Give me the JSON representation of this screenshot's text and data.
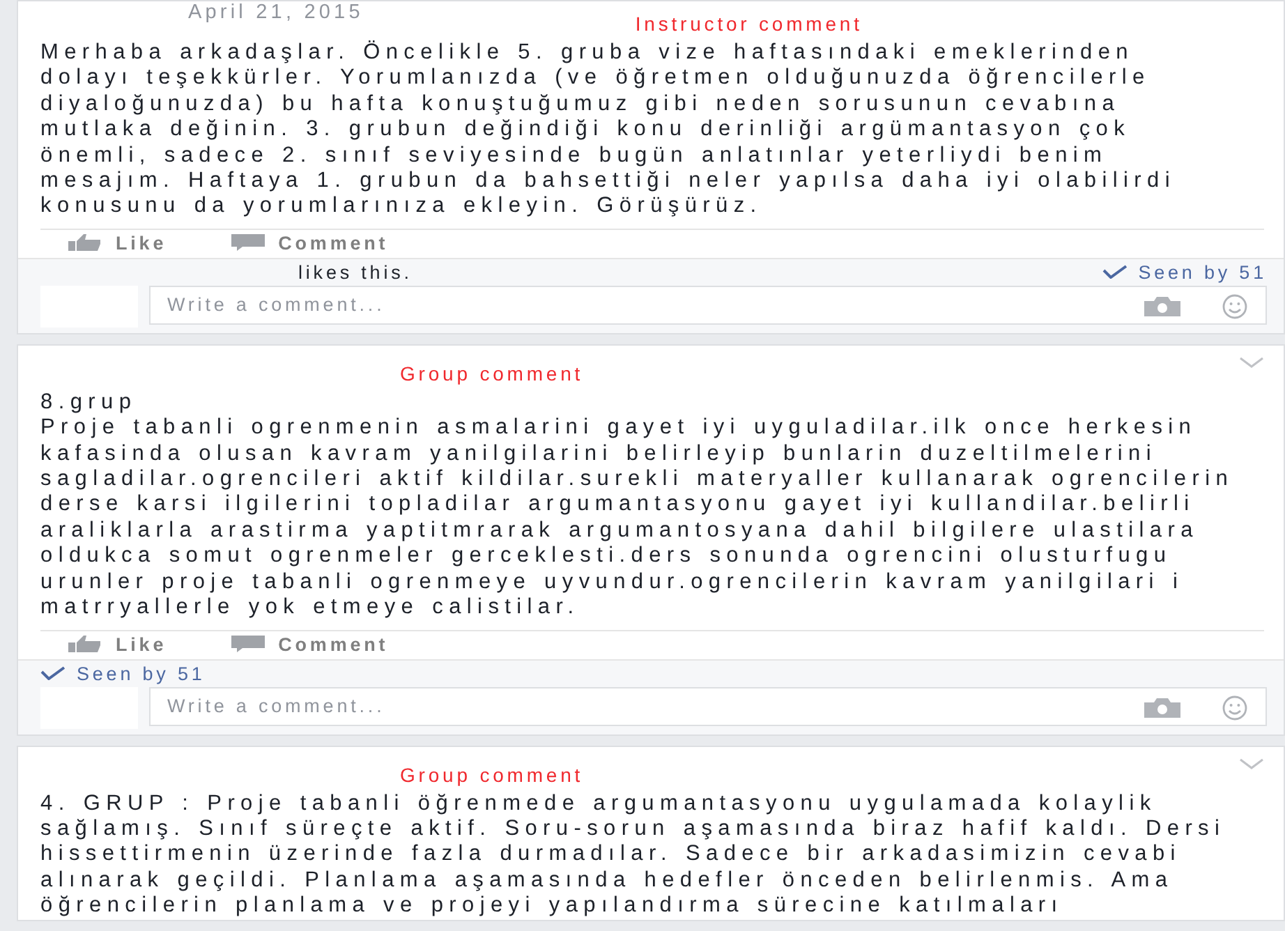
{
  "posts": [
    {
      "date": "April 21, 2015",
      "heading": "Instructor comment",
      "body": "Merhaba arkadaşlar. Öncelikle 5. gruba vize haftasındaki emeklerinden\ndolayı teşekkürler. Yorumlanızda (ve öğretmen olduğunuzda öğrencilerle\ndiyaloğunuzda) bu hafta konuştuğumuz gibi neden sorusunun cevabına\nmutlaka değinin. 3. grubun değindiği konu derinliği argümantasyon çok\nönemli, sadece 2. sınıf seviyesinde bugün anlatınlar yeterliydi benim\nmesajım. Haftaya 1. grubun da bahsettiği neler yapılsa daha iyi olabilirdi\nkonusunu da yorumlarınıza ekleyin. Görüşürüz.",
      "actions": [
        "Like",
        "Comment"
      ],
      "likes": "likes this.",
      "seen": "Seen by 51",
      "comment_placeholder": "Write a comment...",
      "menu": false
    },
    {
      "heading": "Group comment",
      "body": "8.grup\nProje tabanli ogrenmenin asmalarini gayet iyi uyguladilar.ilk once herkesin\nkafasinda olusan kavram yanilgilarini belirleyip bunlarin duzeltilmelerini\nsagladilar.ogrencileri aktif kildilar.surekli materyaller kullanarak ogrencilerin\nderse karsi ilgilerini topladilar argumantasyonu gayet iyi kullandilar.belirli\naraliklarla arastirma yaptitmrarak argumantosyana dahil bilgilere ulastilara\noldukca somut ogrenmeler gerceklesti.ders sonunda ogrencini olusturfugu\nurunler proje tabanli ogrenmeye uyvundur.ogrencilerin kavram yanilgilari i\nmatrryallerle yok etmeye calistilar.",
      "actions": [
        "Like",
        "Comment"
      ],
      "seen": "Seen by 51",
      "comment_placeholder": "Write a comment...",
      "menu": true
    },
    {
      "heading": "Group comment",
      "body": "4. GRUP : Proje tabanli öğrenmede argumantasyonu uygulamada kolaylik\nsağlamış. Sınıf süreçte aktif. Soru-sorun aşamasında biraz hafif kaldı. Dersi\nhissettirmenin üzerinde fazla durmadılar. Sadece bir arkadasimizin cevabi\nalınarak geçildi. Planlama aşamasında hedefler önceden belirlenmis. Ama\nöğrencilerin planlama ve projeyi yapılandırma sürecine katılmaları",
      "menu": true
    }
  ]
}
